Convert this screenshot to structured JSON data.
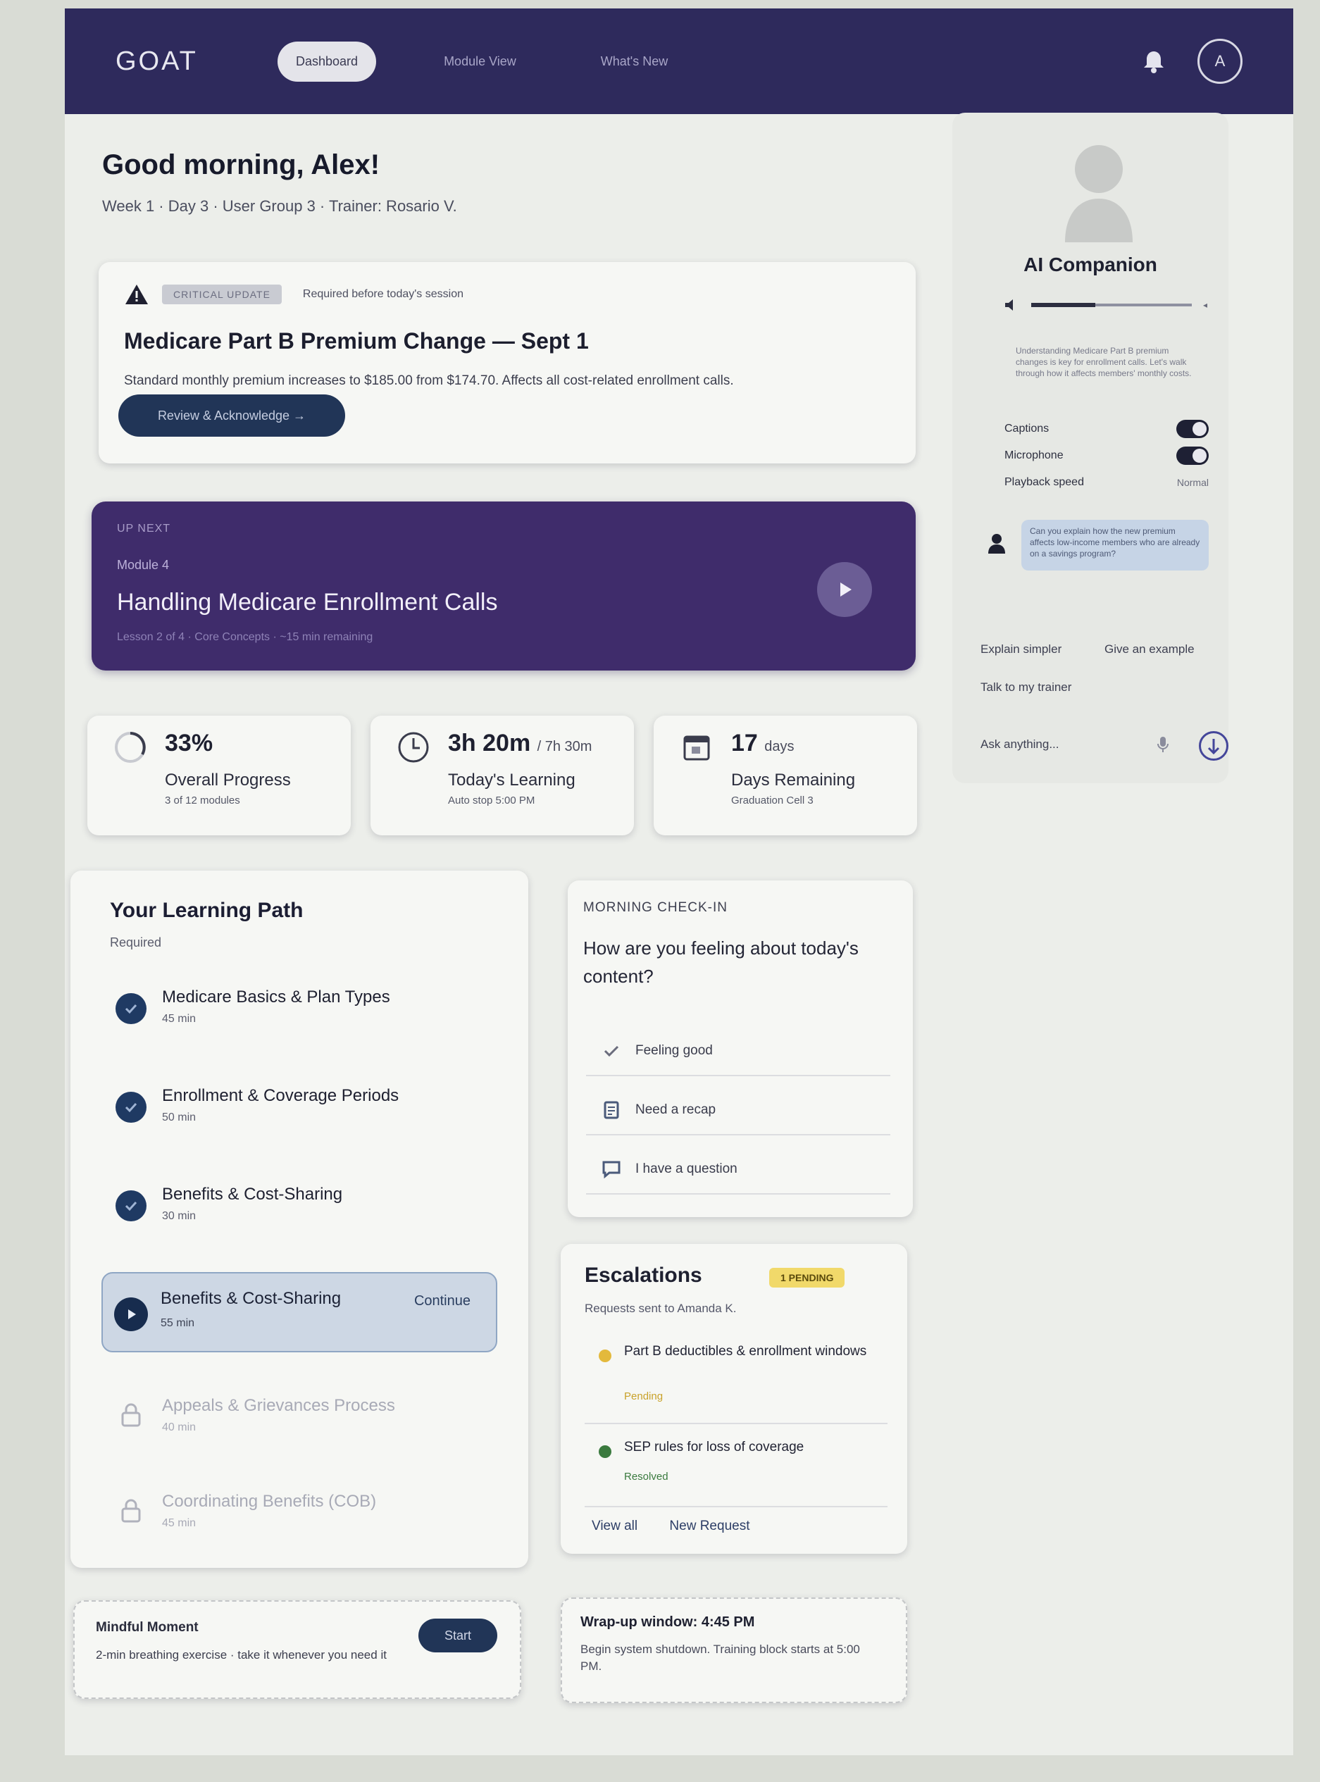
{
  "app": {
    "logo": "GOAT",
    "nav": [
      "Dashboard",
      "Module View",
      "What's New"
    ],
    "avatar_initial": "A"
  },
  "greeting": {
    "title": "Good morning, Alex!",
    "subline": "Week 1 · Day 3 · User Group 3 · Trainer: Rosario V."
  },
  "alert": {
    "badge": "CRITICAL UPDATE",
    "note": "Required before today's session",
    "title": "Medicare Part B Premium Change — Sept 1",
    "body": "Standard monthly premium increases to $185.00 from $174.70. Affects all cost-related enrollment calls.",
    "button": "Review & Acknowledge →"
  },
  "up_next": {
    "kicker": "UP NEXT",
    "module": "Module 4",
    "title": "Handling Medicare Enrollment Calls",
    "meta": "Lesson 2 of 4 · Core Concepts · ~15 min remaining"
  },
  "stats": [
    {
      "value": "33%",
      "unit": "",
      "label": "Overall Progress",
      "sub": "3 of 12 modules",
      "icon": "progress-ring-icon"
    },
    {
      "value": "3h 20m",
      "unit": "/ 7h 30m",
      "label": "Today's Learning",
      "sub": "Auto stop 5:00 PM",
      "icon": "clock-icon"
    },
    {
      "value": "17",
      "unit": "days",
      "label": "Days Remaining",
      "sub": "Graduation Cell 3",
      "icon": "calendar-icon"
    }
  ],
  "learning_path": {
    "title": "Your Learning Path",
    "subtitle": "Required",
    "items": [
      {
        "name": "Medicare Basics & Plan Types",
        "dur": "45 min",
        "state": "done"
      },
      {
        "name": "Enrollment & Coverage Periods",
        "dur": "50 min",
        "state": "done"
      },
      {
        "name": "Benefits & Cost-Sharing",
        "dur": "30 min",
        "state": "done"
      }
    ],
    "active": {
      "name": "Benefits & Cost-Sharing",
      "dur": "55 min",
      "action": "Continue"
    },
    "locked": [
      {
        "name": "Appeals & Grievances Process",
        "dur": "40 min"
      },
      {
        "name": "Coordinating Benefits (COB)",
        "dur": "45 min"
      }
    ]
  },
  "check_in": {
    "kicker": "MORNING CHECK-IN",
    "question": "How are you feeling about today's content?",
    "options": [
      {
        "label": "Feeling good",
        "icon": "check-icon"
      },
      {
        "label": "Need a recap",
        "icon": "notes-icon"
      },
      {
        "label": "I have a question",
        "icon": "chat-icon"
      }
    ]
  },
  "escalations": {
    "title": "Escalations",
    "badge": "1 PENDING",
    "sub": "Requests sent to Amanda K.",
    "items": [
      {
        "title": "Part B deductibles & enrollment windows",
        "status": "Pending",
        "color": "#e3b93c"
      },
      {
        "title": "SEP rules for loss of coverage",
        "status": "Resolved",
        "color": "#3a7a3e"
      }
    ],
    "links": [
      "View all",
      "New Request"
    ]
  },
  "mindful": {
    "title": "Mindful Moment",
    "desc": "2-min breathing exercise · take it whenever you need it",
    "button": "Start"
  },
  "wrap_up": {
    "title": "Wrap-up window: 4:45 PM",
    "desc": "Begin system shutdown. Training block starts at 5:00 PM."
  },
  "ai": {
    "title": "AI Companion",
    "text": "Understanding Medicare Part B premium changes is key for enrollment calls. Let's walk through how it affects members' monthly costs.",
    "toggles": [
      "Captions",
      "Microphone"
    ],
    "speed_label": "Playback speed",
    "speed_value": "Normal",
    "message": "Can you explain how the new premium affects low-income members who are already on a savings program?",
    "chips": [
      "Explain simpler",
      "Give an example",
      "Talk to my trainer"
    ],
    "input_placeholder": "Ask anything..."
  },
  "colors": {
    "nav_bg": "#2e2a5c",
    "up_next_bg": "#3f2c6b",
    "primary_button": "#213557",
    "pending": "#e3b93c",
    "resolved": "#3a7a3e"
  }
}
